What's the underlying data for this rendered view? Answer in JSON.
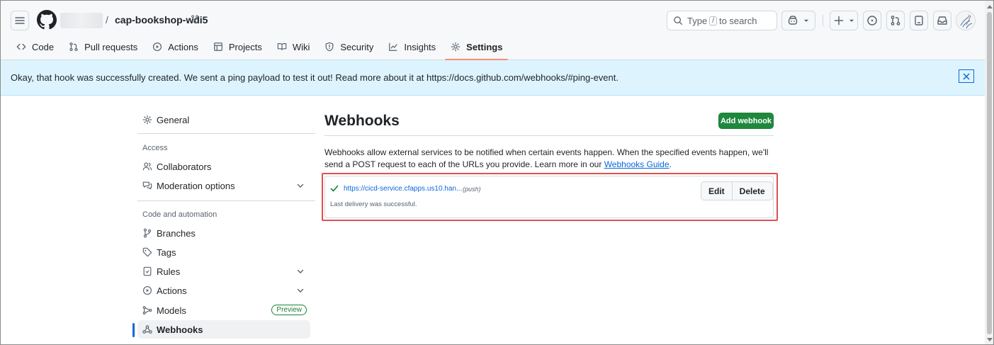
{
  "header": {
    "repo_separator": "/",
    "repo_name": "cap-bookshop-wdi5",
    "search": {
      "prefix": "Type",
      "key": "/",
      "suffix": "to search"
    }
  },
  "tabs": [
    {
      "label": "Code",
      "icon": "code-icon"
    },
    {
      "label": "Pull requests",
      "icon": "git-pull-request-icon"
    },
    {
      "label": "Actions",
      "icon": "play-icon"
    },
    {
      "label": "Projects",
      "icon": "table-icon"
    },
    {
      "label": "Wiki",
      "icon": "book-icon"
    },
    {
      "label": "Security",
      "icon": "shield-icon"
    },
    {
      "label": "Insights",
      "icon": "graph-icon"
    },
    {
      "label": "Settings",
      "icon": "gear-icon",
      "selected": true
    }
  ],
  "flash": {
    "message": "Okay, that hook was successfully created. We sent a ping payload to test it out! Read more about it at https://docs.github.com/webhooks/#ping-event."
  },
  "sidebar": {
    "general": "General",
    "access_heading": "Access",
    "collaborators": "Collaborators",
    "moderation": "Moderation options",
    "code_heading": "Code and automation",
    "branches": "Branches",
    "tags": "Tags",
    "rules": "Rules",
    "actions": "Actions",
    "models": "Models",
    "models_badge": "Preview",
    "webhooks": "Webhooks"
  },
  "main": {
    "title": "Webhooks",
    "add_button": "Add webhook",
    "description": "Webhooks allow external services to be notified when certain events happen. When the specified events happen, we'll send a POST request to each of the URLs you provide. Learn more in our",
    "guide_link": "Webhooks Guide",
    "description_end": ".",
    "hook": {
      "url": "https://cicd-service.cfapps.us10.han...",
      "events": "(push)",
      "status": "Last delivery was successful.",
      "edit_label": "Edit",
      "delete_label": "Delete"
    }
  },
  "colors": {
    "accent": "#0969da",
    "primary_button": "#1f883d",
    "flash_bg": "#ddf4ff",
    "highlight": "#e05050",
    "tab_underline": "#fd8c73"
  }
}
